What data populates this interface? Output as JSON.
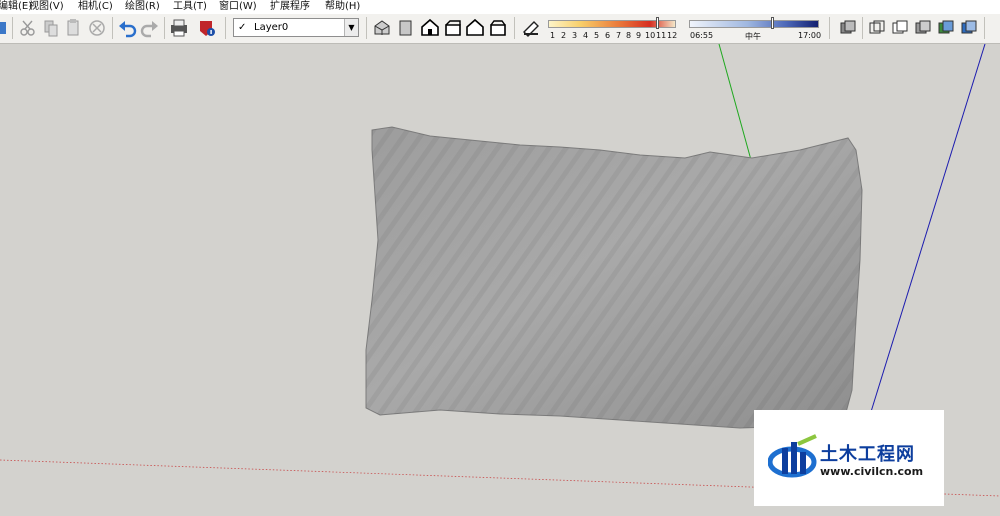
{
  "menu": {
    "items": [
      "编辑(E)",
      "视图(V)",
      "相机(C)",
      "绘图(R)",
      "工具(T)",
      "窗口(W)",
      "扩展程序",
      "帮助(H)"
    ]
  },
  "layer": {
    "check": "✓",
    "name": "Layer0",
    "dropdown_icon": "chevron-down-icon"
  },
  "shadow_settings": {
    "month_ticks": [
      "1",
      "2",
      "3",
      "4",
      "5",
      "6",
      "7",
      "8",
      "9",
      "10",
      "11",
      "12"
    ],
    "time_start": "06:55",
    "time_mid": "中午",
    "time_end": "17:00"
  },
  "watermark": {
    "name": "土木工程网",
    "url": "www.civilcn.com"
  },
  "colors": {
    "background": "#d3d2ce",
    "green_axis": "#1fa81f",
    "blue_axis": "#1c1caf",
    "red_axis": "#c84b4b",
    "logo_blue": "#0d3e9e"
  }
}
